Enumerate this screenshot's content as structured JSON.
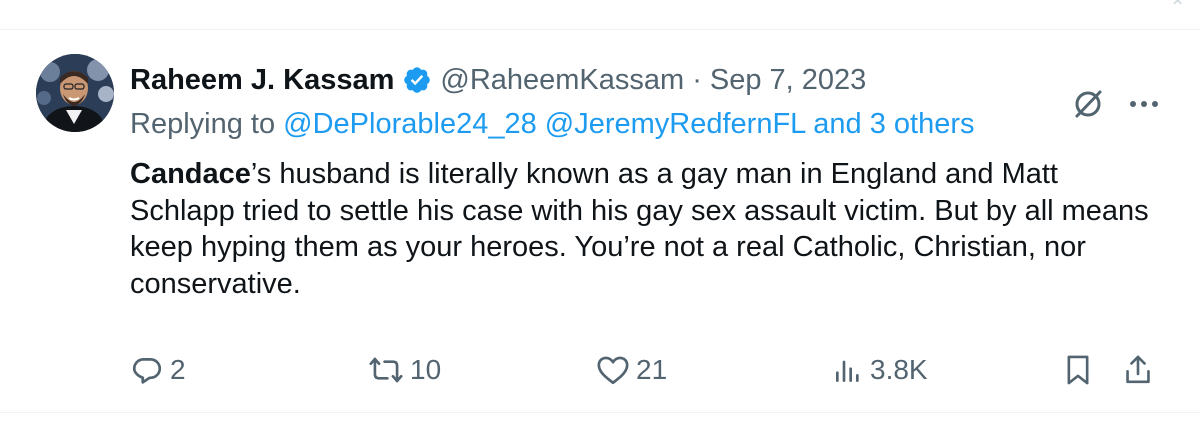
{
  "tweet": {
    "author": {
      "display_name": "Raheem J. Kassam",
      "handle": "@RaheemKassam",
      "verified_icon": "verified-badge-icon",
      "avatar": "avatar-photo"
    },
    "separator": "·",
    "date": "Sep 7, 2023",
    "reply": {
      "prefix": "Replying to",
      "mentions": [
        "@DePlorable24_28",
        "@JeremyRedfernFL",
        "and 3 others"
      ]
    },
    "body": {
      "bold_lead": "Candace",
      "rest": "’s husband is literally known as a gay man in England and Matt Schlapp tried to settle his case with his gay sex assault victim. But by all means keep hyping them as your heroes. You’re not a real Catholic, Christian, nor conservative."
    },
    "actions": {
      "replies": "2",
      "retweets": "10",
      "likes": "21",
      "views": "3.8K"
    }
  },
  "colors": {
    "accent": "#1d9bf0",
    "text_primary": "#0f1419",
    "text_secondary": "#536471",
    "divider": "#eff3f4"
  }
}
